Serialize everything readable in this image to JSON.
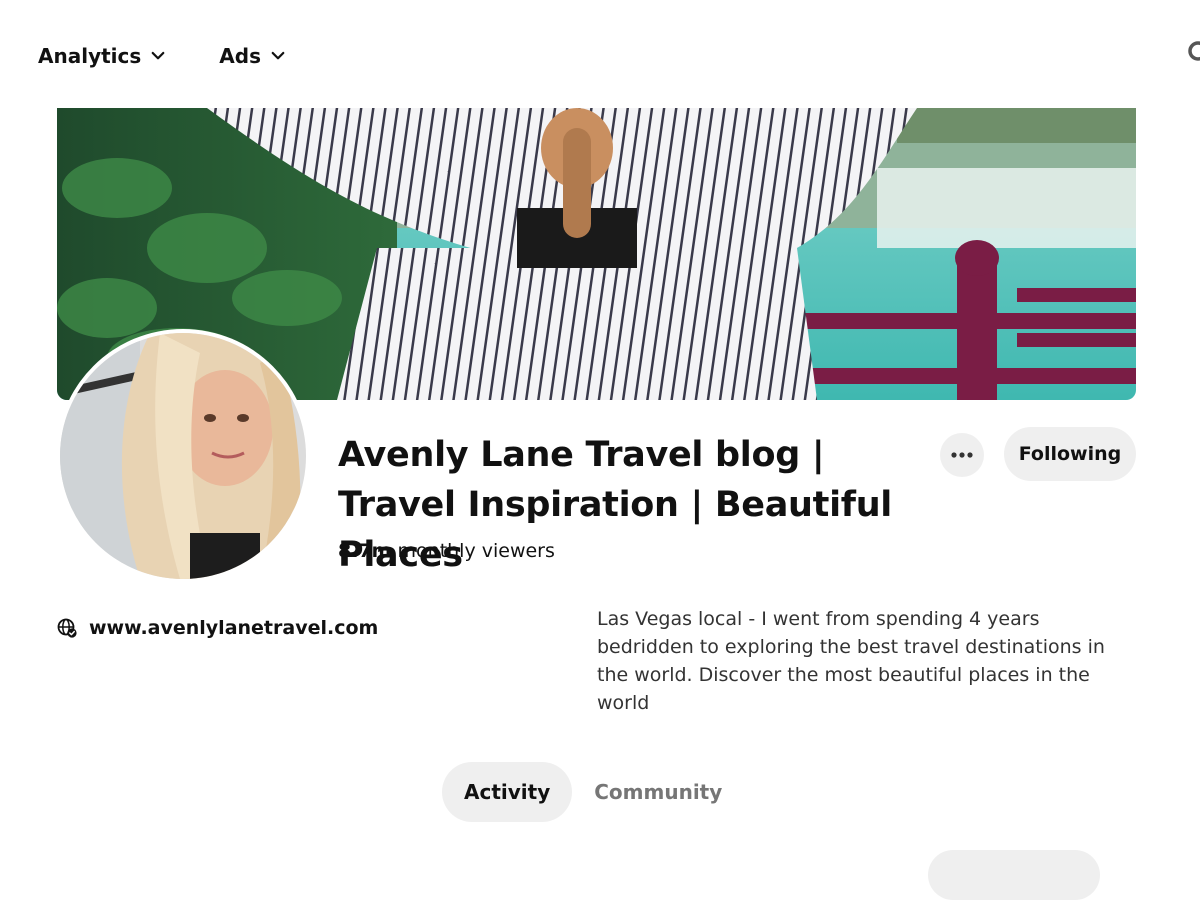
{
  "nav": {
    "items": [
      {
        "label": "Analytics",
        "icon": "chevron-down-icon"
      },
      {
        "label": "Ads",
        "icon": "chevron-down-icon"
      }
    ],
    "search_icon": "search-icon"
  },
  "profile": {
    "name": "Avenly Lane Travel blog | Travel Inspiration | Beautiful Places",
    "viewers_count": "8.7m",
    "viewers_label": "monthly viewers",
    "more_icon": "more-options-icon",
    "follow_label": "Following",
    "website": "www.avenlylanetravel.com",
    "website_icon": "verified-globe-icon",
    "bio": "Las Vegas local - I went from spending 4 years bedridden to exploring the best travel destinations in the world. Discover the most beautiful places in the world"
  },
  "tabs": [
    {
      "label": "Activity",
      "active": true
    },
    {
      "label": "Community",
      "active": false
    }
  ],
  "colors": {
    "button_bg": "#efefef",
    "text": "#111111",
    "muted": "#767676"
  }
}
